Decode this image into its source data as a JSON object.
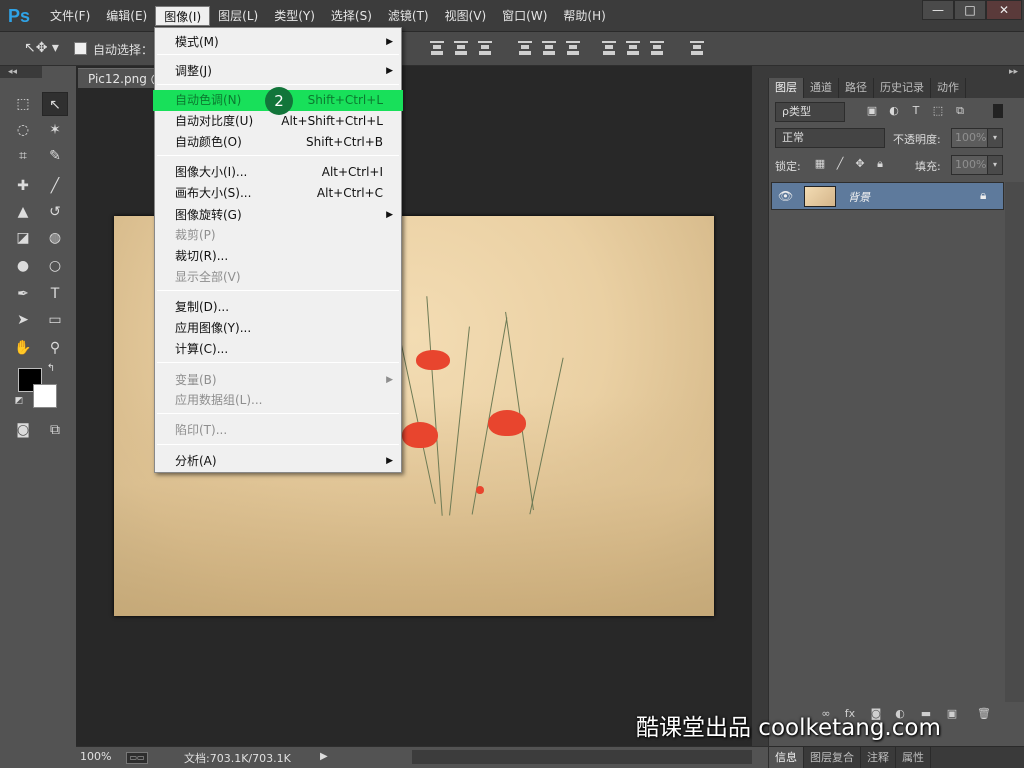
{
  "app": {
    "logo": "Ps"
  },
  "menubar": {
    "items": [
      "文件(F)",
      "编辑(E)",
      "图像(I)",
      "图层(L)",
      "类型(Y)",
      "选择(S)",
      "滤镜(T)",
      "视图(V)",
      "窗口(W)",
      "帮助(H)"
    ],
    "active_index": 2
  },
  "window_controls": {
    "minimize": "—",
    "maximize": "□",
    "close": "✕"
  },
  "options_bar": {
    "auto_select_label": "自动选择："
  },
  "document": {
    "tab_title": "Pic12.png @",
    "zoom": "100%",
    "info": "文档:703.1K/703.1K"
  },
  "image_menu": {
    "items": [
      {
        "label": "模式(M)",
        "shortcut": "",
        "submenu": true,
        "disabled": false,
        "highlight": false
      },
      {
        "label": "调整(J)",
        "shortcut": "",
        "submenu": true,
        "disabled": false,
        "highlight": false
      },
      {
        "label": "自动色调(N)",
        "shortcut": "Shift+Ctrl+L",
        "submenu": false,
        "disabled": false,
        "highlight": true
      },
      {
        "label": "自动对比度(U)",
        "shortcut": "Alt+Shift+Ctrl+L",
        "submenu": false,
        "disabled": false,
        "highlight": false
      },
      {
        "label": "自动颜色(O)",
        "shortcut": "Shift+Ctrl+B",
        "submenu": false,
        "disabled": false,
        "highlight": false
      },
      {
        "label": "图像大小(I)...",
        "shortcut": "Alt+Ctrl+I",
        "submenu": false,
        "disabled": false,
        "highlight": false
      },
      {
        "label": "画布大小(S)...",
        "shortcut": "Alt+Ctrl+C",
        "submenu": false,
        "disabled": false,
        "highlight": false
      },
      {
        "label": "图像旋转(G)",
        "shortcut": "",
        "submenu": true,
        "disabled": false,
        "highlight": false
      },
      {
        "label": "裁剪(P)",
        "shortcut": "",
        "submenu": false,
        "disabled": true,
        "highlight": false
      },
      {
        "label": "裁切(R)...",
        "shortcut": "",
        "submenu": false,
        "disabled": false,
        "highlight": false
      },
      {
        "label": "显示全部(V)",
        "shortcut": "",
        "submenu": false,
        "disabled": true,
        "highlight": false
      },
      {
        "label": "复制(D)...",
        "shortcut": "",
        "submenu": false,
        "disabled": false,
        "highlight": false
      },
      {
        "label": "应用图像(Y)...",
        "shortcut": "",
        "submenu": false,
        "disabled": false,
        "highlight": false
      },
      {
        "label": "计算(C)...",
        "shortcut": "",
        "submenu": false,
        "disabled": false,
        "highlight": false
      },
      {
        "label": "变量(B)",
        "shortcut": "",
        "submenu": true,
        "disabled": true,
        "highlight": false
      },
      {
        "label": "应用数据组(L)...",
        "shortcut": "",
        "submenu": false,
        "disabled": true,
        "highlight": false
      },
      {
        "label": "陷印(T)...",
        "shortcut": "",
        "submenu": false,
        "disabled": true,
        "highlight": false
      },
      {
        "label": "分析(A)",
        "shortcut": "",
        "submenu": true,
        "disabled": false,
        "highlight": false
      }
    ],
    "step_badge": "2",
    "highlight_color": "#18e05a"
  },
  "layers_panel": {
    "tabs": [
      "图层",
      "通道",
      "路径",
      "历史记录",
      "动作"
    ],
    "filter_kind": "ρ类型",
    "blend_mode": "正常",
    "opacity_label": "不透明度:",
    "opacity_value": "100%",
    "lock_label": "锁定:",
    "fill_label": "填充:",
    "fill_value": "100%",
    "layer": {
      "name": "背景"
    }
  },
  "bottom_tabs": [
    "信息",
    "图层复合",
    "注释",
    "属性"
  ],
  "watermark": "酷课堂出品 coolketang.com",
  "icons": {
    "tools": [
      "marquee-icon",
      "move-icon",
      "lasso-icon",
      "magic-wand-icon",
      "crop-icon",
      "eyedropper-icon",
      "healing-brush-icon",
      "brush-icon",
      "clone-stamp-icon",
      "history-brush-icon",
      "eraser-icon",
      "paint-bucket-icon",
      "blur-icon",
      "dodge-icon",
      "pen-icon",
      "type-icon",
      "path-select-icon",
      "rectangle-icon",
      "hand-icon",
      "zoom-icon"
    ]
  }
}
